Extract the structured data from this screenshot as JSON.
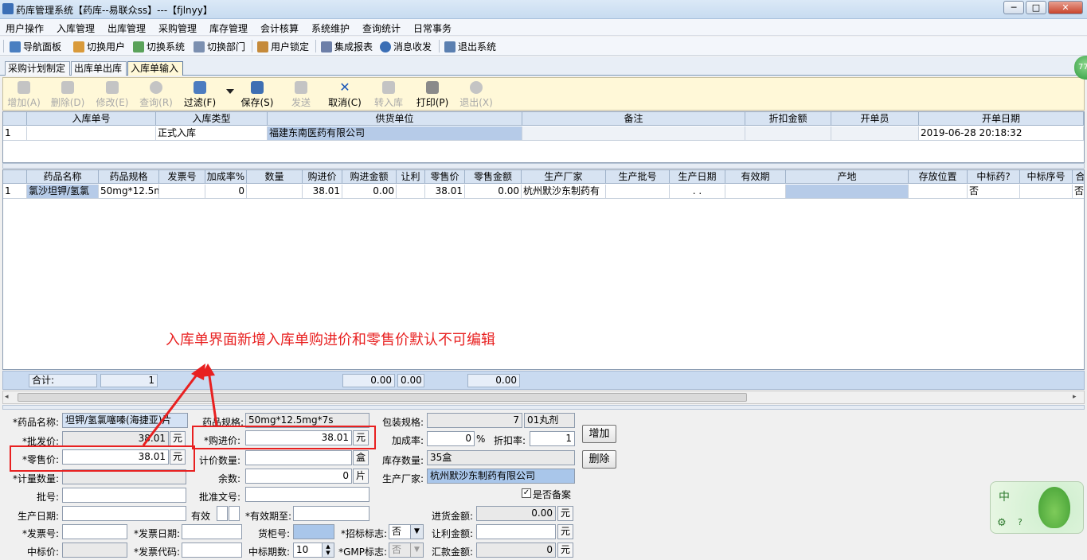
{
  "window": {
    "title": "药库管理系统【药库--易联众ss】---【fjlnyy】",
    "min": "─",
    "max": "□",
    "close": "✕"
  },
  "menu": [
    "用户操作",
    "入库管理",
    "出库管理",
    "采购管理",
    "库存管理",
    "会计核算",
    "系统维护",
    "查询统计",
    "日常事务"
  ],
  "quickbar": [
    "导航面板",
    "切换用户",
    "切换系统",
    "切换部门",
    "用户锁定",
    "集成报表",
    "消息收发",
    "退出系统"
  ],
  "tabs": [
    "采购计划制定",
    "出库单出库",
    "入库单输入"
  ],
  "toolbar": {
    "add": "增加(A)",
    "delete": "删除(D)",
    "modify": "修改(E)",
    "query": "查询(R)",
    "filter": "过滤(F)",
    "save": "保存(S)",
    "send": "发送",
    "cancel": "取消(C)",
    "transfer": "转入库",
    "print": "打印(P)",
    "exit": "退出(X)"
  },
  "top_grid": {
    "headers": [
      "入库单号",
      "入库类型",
      "供货单位",
      "备注",
      "折扣金额",
      "开单员",
      "开单日期"
    ],
    "row": {
      "idx": "1",
      "no": "",
      "type": "正式入库",
      "supplier": "福建东南医药有限公司",
      "remark": "",
      "discount": "",
      "clerk": "",
      "date": "2019-06-28 20:18:32"
    }
  },
  "detail_grid": {
    "headers": [
      "药品名称",
      "药品规格",
      "发票号",
      "加成率%",
      "数量",
      "购进价",
      "购进金额",
      "让利",
      "零售价",
      "零售金额",
      "生产厂家",
      "生产批号",
      "生产日期",
      "有效期",
      "产地",
      "存放位置",
      "中标药?",
      "中标序号",
      "合"
    ],
    "row": {
      "idx": "1",
      "name": "氯沙坦钾/氢氯",
      "spec": "50mg*12.5m",
      "invoice": "",
      "markup": "0",
      "qty": "",
      "buy_price": "38.01",
      "buy_amount": "0.00",
      "discount": "",
      "retail_price": "38.01",
      "retail_amount": "0.00",
      "maker": "杭州默沙东制药有",
      "batch": "",
      "prod_date": ". .",
      "expiry": "",
      "origin": "",
      "location": "",
      "bid": "否",
      "bid_no": "",
      "extra": "否"
    }
  },
  "annotation": "入库单界面新增入库单购进价和零售价默认不可编辑",
  "totals": {
    "label": "合计:",
    "count": "1",
    "buy_amount": "0.00",
    "discount": "0.00",
    "retail_amount": "0.00"
  },
  "form": {
    "drug_name_label": "*药品名称:",
    "drug_name": "坦钾/氢氯噻嗪(海捷亚)片",
    "spec_label": "药品规格:",
    "spec": "50mg*12.5mg*7s",
    "pack_label": "包装规格:",
    "pack_qty": "7",
    "pack_unit": "01丸剂",
    "wholesale_label": "*批发价:",
    "wholesale": "38.01",
    "yuan": "元",
    "buy_label": "*购进价:",
    "buy_price": "38.01",
    "markup_label": "加成率:",
    "markup": "0",
    "pct": "%",
    "discount_rate_label": "折扣率:",
    "discount_rate": "1",
    "retail_label": "*零售价:",
    "retail": "38.01",
    "price_qty_label": "计价数量:",
    "price_qty": "",
    "box_unit": "盒",
    "stock_label": "库存数量:",
    "stock": "35盒",
    "measure_label": "*计量数量:",
    "measure": "",
    "remain_label": "余数:",
    "remain": "0",
    "piece_unit": "片",
    "maker_label": "生产厂家:",
    "maker": "杭州默沙东制药有限公司",
    "batch_label": "批号:",
    "batch": "",
    "approval_label": "批准文号:",
    "approval": "",
    "record_label": "是否备案",
    "record_checked": "✓",
    "prod_date_label": "生产日期:",
    "prod_date": "",
    "valid_label": "有效",
    "expiry_label": "*有效期至:",
    "expiry": "",
    "purchase_amt_label": "进货金额:",
    "purchase_amt": "0.00",
    "invoice_label": "*发票号:",
    "invoice": "",
    "invoice_date_label": "*发票日期:",
    "invoice_date": "",
    "shelf_label": "货柜号:",
    "shelf": "",
    "bid_flag_label": "*招标标志:",
    "bid_flag": "否",
    "profit_label": "让利金额:",
    "profit": "",
    "bid_price_label": "中标价:",
    "bid_price": "",
    "invoice_code_label": "*发票代码:",
    "invoice_code": "",
    "bid_period_label": "中标期数:",
    "bid_period": "10",
    "gmp_label": "*GMP标志:",
    "gmp": "否",
    "remit_label": "汇款金额:",
    "remit": "0",
    "add_button": "增加",
    "delete_button": "删除"
  },
  "floating_widget": {
    "text": "中",
    "badge": "77"
  }
}
